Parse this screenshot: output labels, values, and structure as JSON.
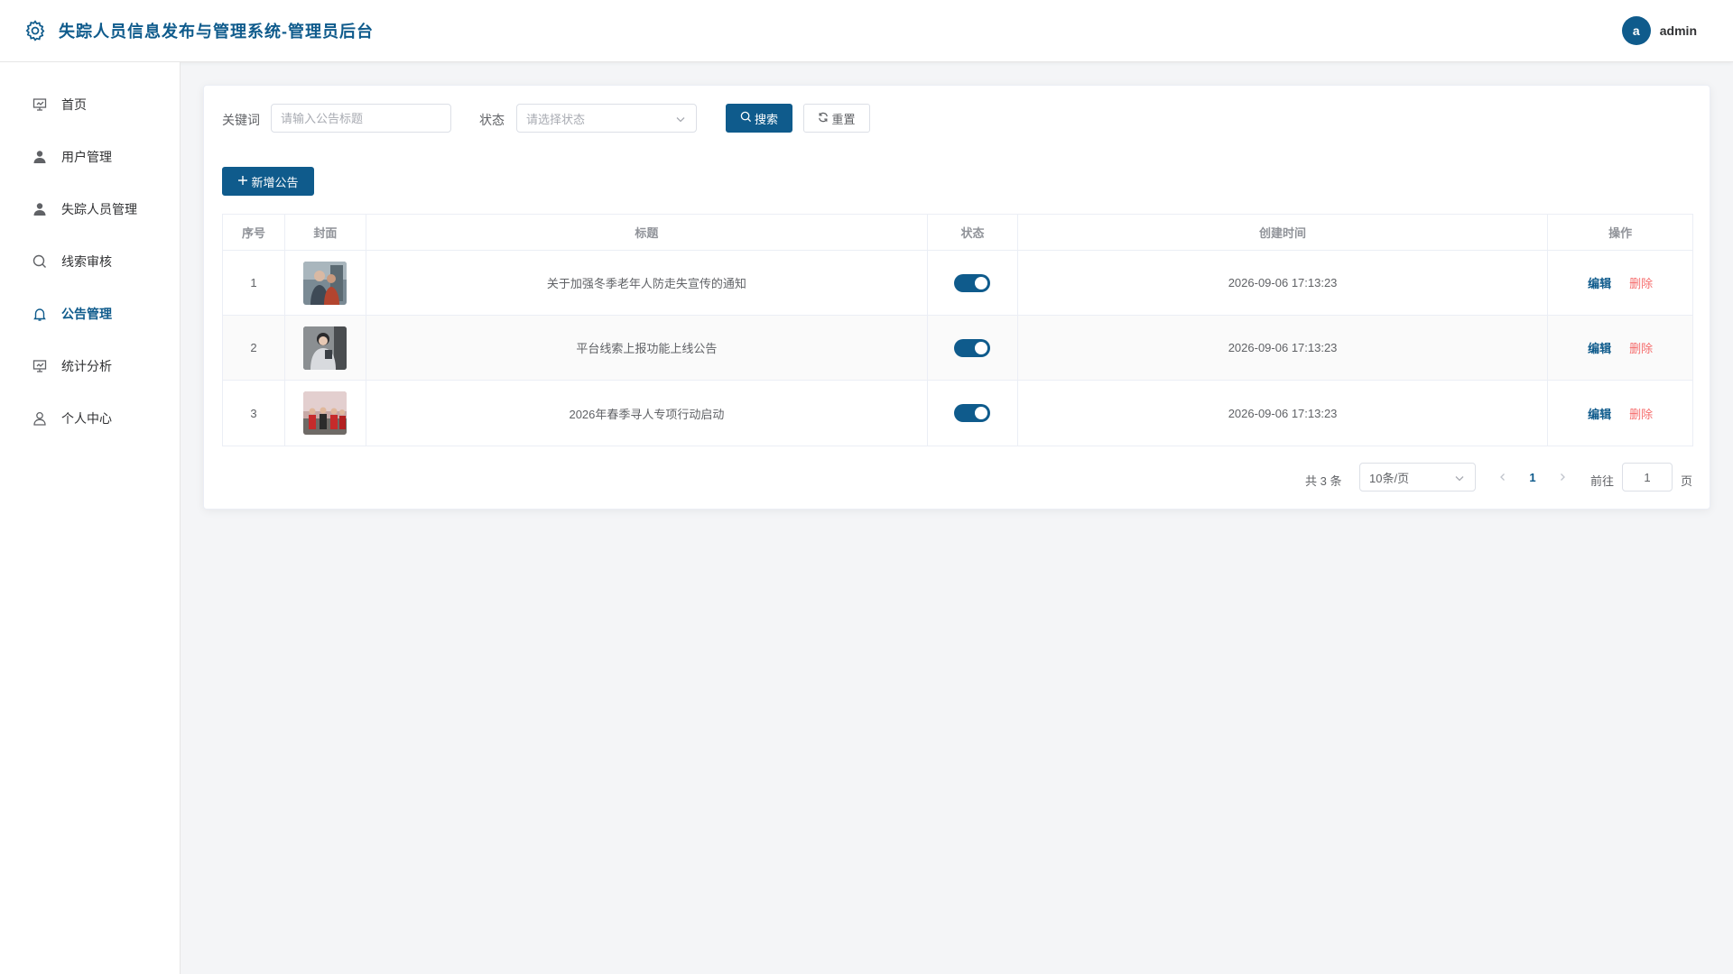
{
  "header": {
    "title": "失踪人员信息发布与管理系统-管理员后台",
    "avatar_letter": "a",
    "username": "admin",
    "logo_icon": "gear-icon"
  },
  "sidebar": {
    "items": [
      {
        "label": "首页",
        "icon": "presentation-icon",
        "active": false
      },
      {
        "label": "用户管理",
        "icon": "user-filled-icon",
        "active": false
      },
      {
        "label": "失踪人员管理",
        "icon": "user-filled-icon",
        "active": false
      },
      {
        "label": "线索审核",
        "icon": "search-icon",
        "active": false
      },
      {
        "label": "公告管理",
        "icon": "bell-icon",
        "active": true
      },
      {
        "label": "统计分析",
        "icon": "presentation-icon",
        "active": false
      },
      {
        "label": "个人中心",
        "icon": "user-outline-icon",
        "active": false
      }
    ]
  },
  "filters": {
    "keyword_label": "关键词",
    "keyword_placeholder": "请输入公告标题",
    "keyword_value": "",
    "status_label": "状态",
    "status_placeholder": "请选择状态",
    "search_label": "搜索",
    "reset_label": "重置"
  },
  "toolbar": {
    "add_label": "新增公告"
  },
  "table": {
    "columns": [
      "序号",
      "封面",
      "标题",
      "状态",
      "创建时间",
      "操作"
    ],
    "rows": [
      {
        "index": "1",
        "title": "关于加强冬季老年人防走失宣传的通知",
        "status_on": true,
        "created": "2026-09-06 17:13:23",
        "edit": "编辑",
        "delete": "删除"
      },
      {
        "index": "2",
        "title": "平台线索上报功能上线公告",
        "status_on": true,
        "created": "2026-09-06 17:13:23",
        "edit": "编辑",
        "delete": "删除"
      },
      {
        "index": "3",
        "title": "2026年春季寻人专项行动启动",
        "status_on": true,
        "created": "2026-09-06 17:13:23",
        "edit": "编辑",
        "delete": "删除"
      }
    ]
  },
  "pagination": {
    "total_text": "共 3 条",
    "page_size": "10条/页",
    "current_page": "1",
    "goto_label": "前往",
    "goto_value": "1",
    "page_suffix": "页"
  },
  "colors": {
    "primary": "#0f5b8c",
    "danger": "#f56c6c",
    "background": "#f4f5f7"
  }
}
